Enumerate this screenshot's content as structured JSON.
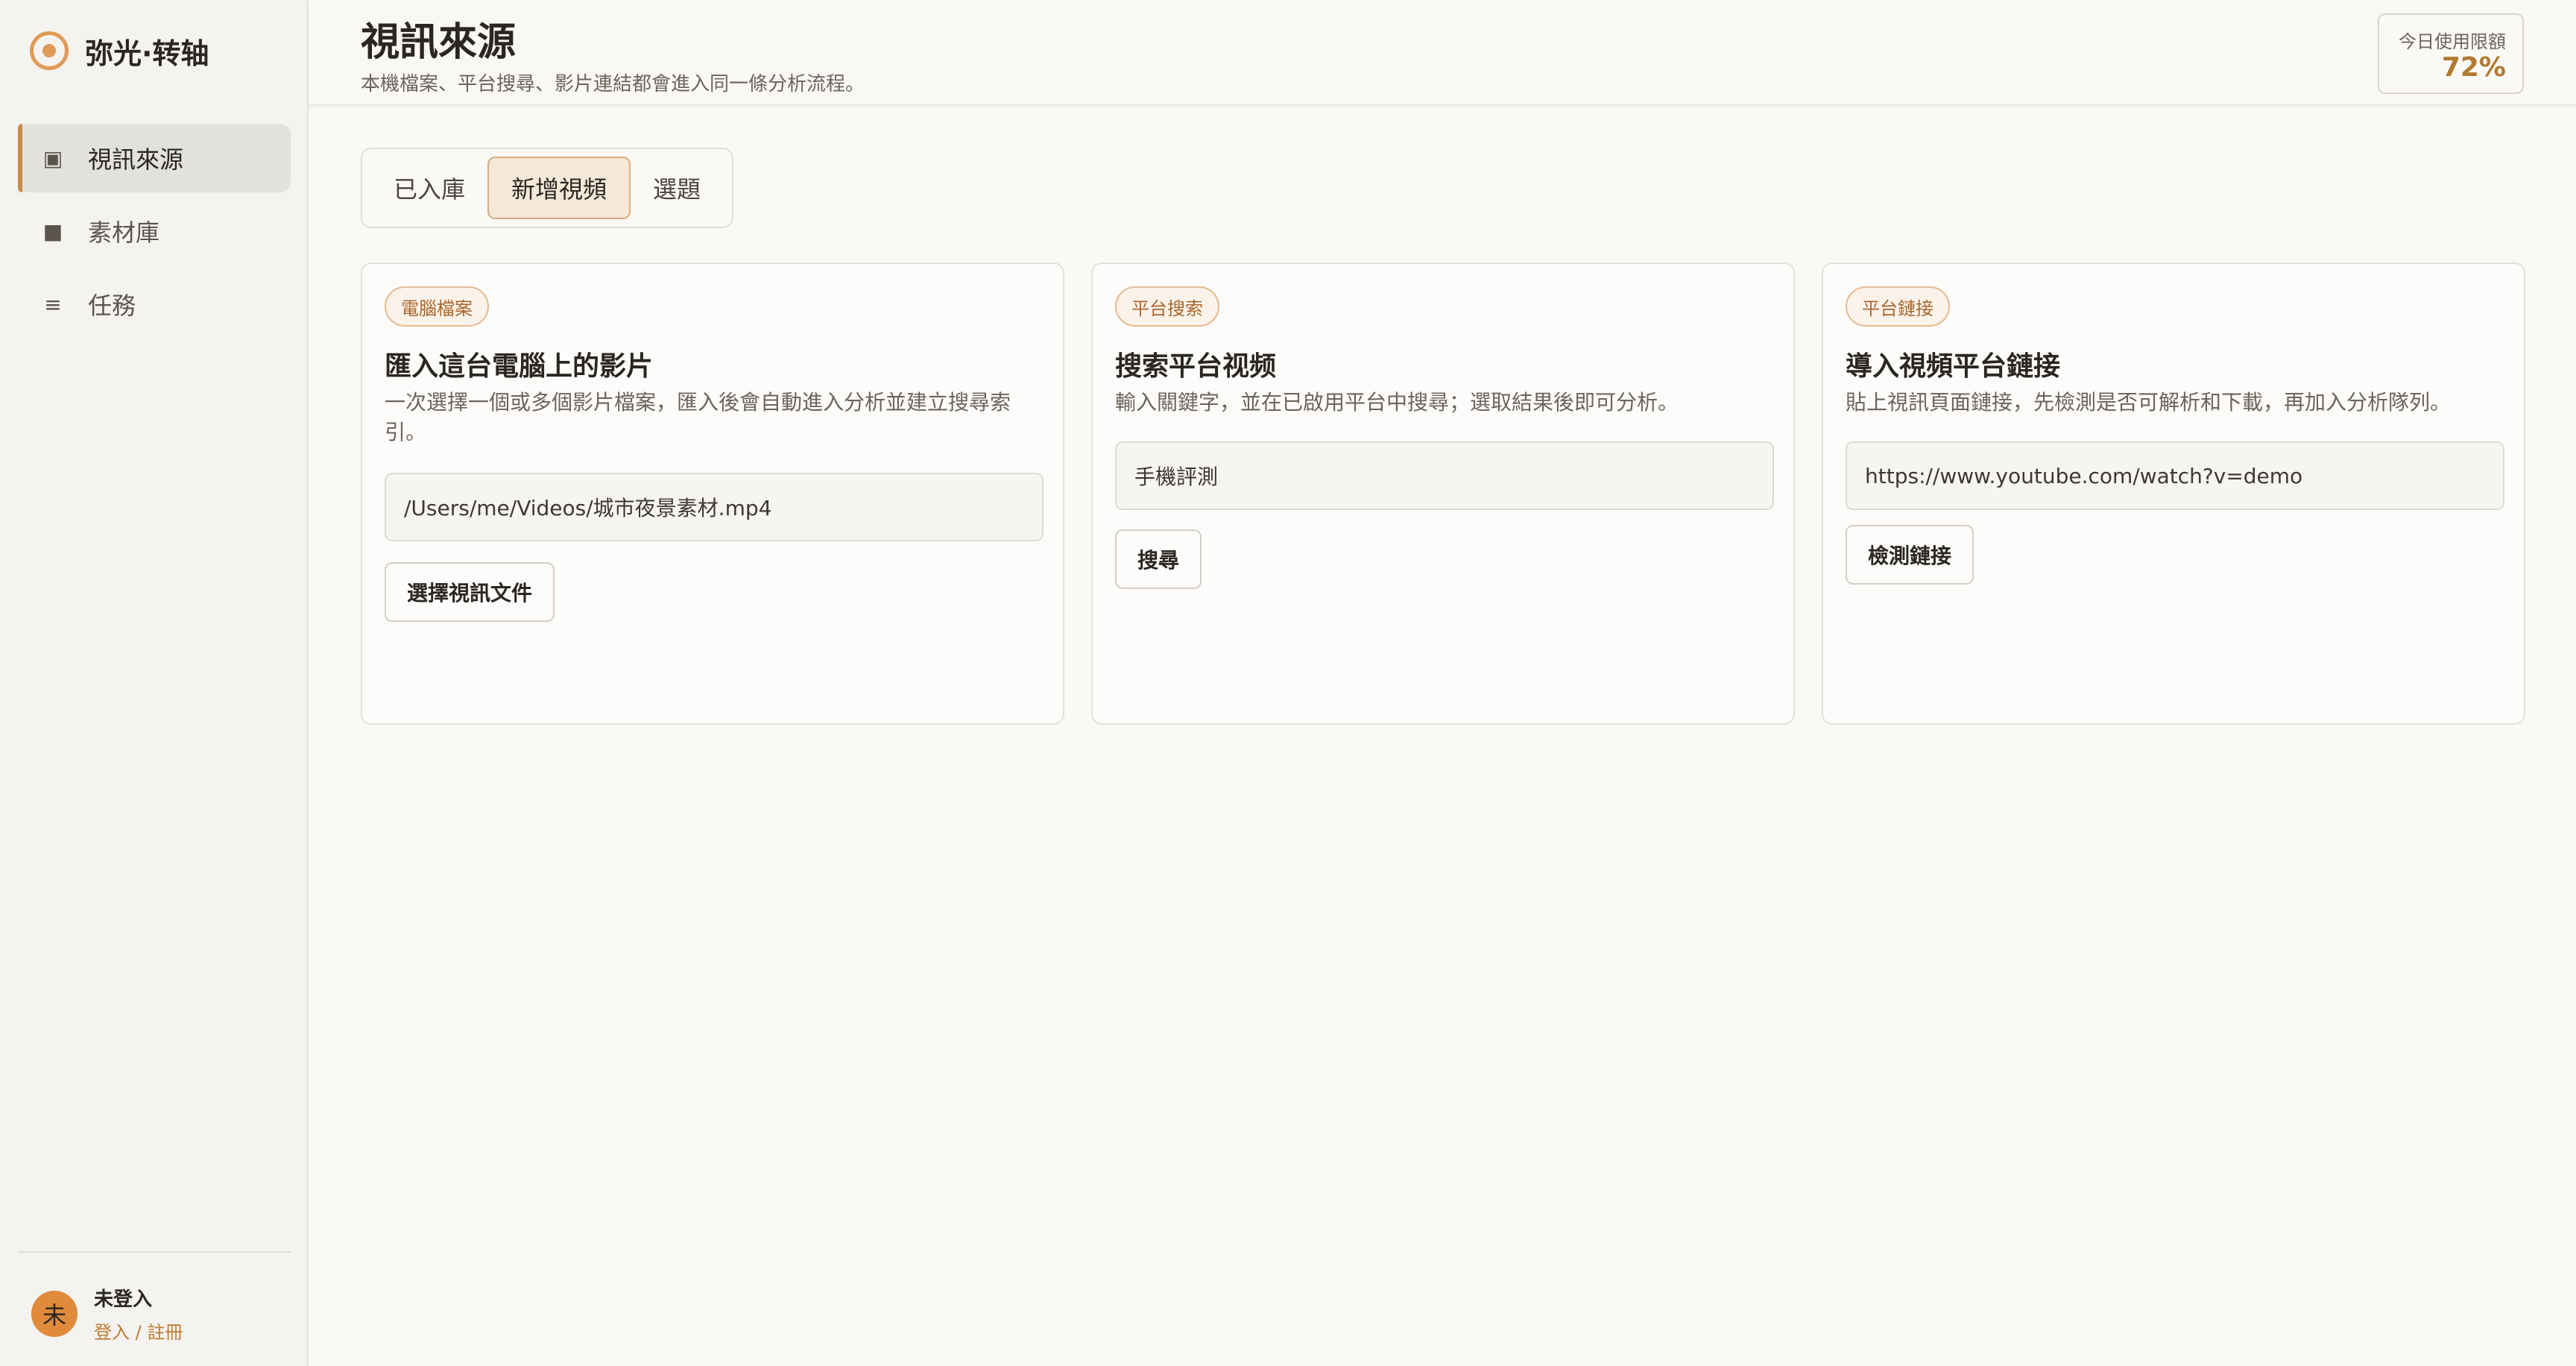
{
  "app": {
    "name": "弥光·转轴"
  },
  "sidebar": {
    "items": [
      {
        "icon": "square-filled-icon",
        "glyph": "▣",
        "label": "視訊來源"
      },
      {
        "icon": "square-icon",
        "glyph": "■",
        "label": "素材庫"
      },
      {
        "icon": "list-icon",
        "glyph": "≡",
        "label": "任務"
      }
    ],
    "user": {
      "avatar": "未",
      "name": "未登入",
      "link": "登入 / 註冊"
    }
  },
  "header": {
    "title": "視訊來源",
    "subtitle": "本機檔案、平台搜尋、影片連結都會進入同一條分析流程。",
    "quota_label": "今日使用限額",
    "quota_value": "72%"
  },
  "tabs": [
    {
      "label": "已入庫"
    },
    {
      "label": "新增視頻"
    },
    {
      "label": "選題"
    }
  ],
  "cards": [
    {
      "badge": "電腦檔案",
      "title": "匯入這台電腦上的影片",
      "description": "一次選擇一個或多個影片檔案，匯入後會自動進入分析並建立搜尋索引。",
      "input_value": "/Users/me/Videos/城市夜景素材.mp4",
      "button": "選擇視訊文件"
    },
    {
      "badge": "平台搜索",
      "title": "搜索平台视频",
      "description": "輸入關鍵字，並在已啟用平台中搜尋；選取結果後即可分析。",
      "input_value": "手機評測",
      "button": "搜尋"
    },
    {
      "badge": "平台鏈接",
      "title": "導入視頻平台鏈接",
      "description": "貼上視訊頁面鏈接，先檢測是否可解析和下載，再加入分析隊列。",
      "input_value": "https://www.youtube.com/watch?v=demo",
      "button": "檢測鏈接"
    }
  ],
  "colors": {
    "accent": "#c98a48",
    "badge_text": "#a9652c",
    "quota_value": "#b07a30",
    "avatar": "#e08a3c"
  }
}
